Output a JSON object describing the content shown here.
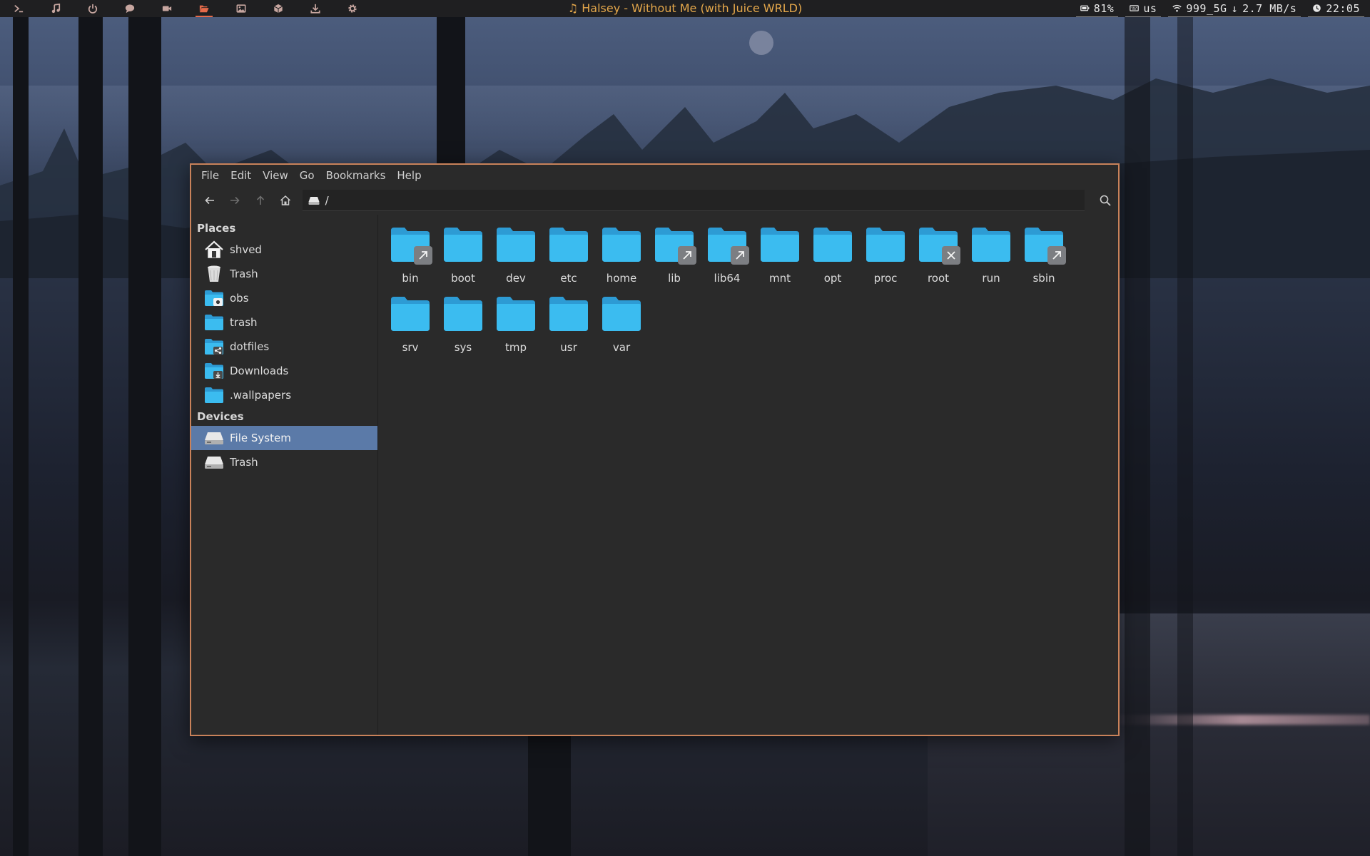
{
  "topbar": {
    "workspaces": [
      {
        "icon": "terminal-icon"
      },
      {
        "icon": "music-icon"
      },
      {
        "icon": "power-icon"
      },
      {
        "icon": "chat-icon"
      },
      {
        "icon": "video-icon"
      },
      {
        "icon": "folder-open-icon",
        "active": true
      },
      {
        "icon": "image-icon"
      },
      {
        "icon": "cube-icon"
      },
      {
        "icon": "download-icon"
      },
      {
        "icon": "settings-icon"
      }
    ],
    "now_playing": "Halsey - Without Me (with Juice WRLD)",
    "battery": "81%",
    "keyboard_layout": "us",
    "wifi": "999_5G",
    "net_speed": "2.7 MB/s",
    "clock": "22:05",
    "accent_color": "#e56a4a",
    "title_color": "#e5a84b"
  },
  "window": {
    "border_color": "#c9825a",
    "menu": [
      "File",
      "Edit",
      "View",
      "Go",
      "Bookmarks",
      "Help"
    ],
    "path": "/",
    "sidebar": {
      "places_title": "Places",
      "places": [
        {
          "label": "shved",
          "icon": "home-icon"
        },
        {
          "label": "Trash",
          "icon": "trash-bin-icon"
        },
        {
          "label": "obs",
          "icon": "camera-folder-icon"
        },
        {
          "label": "trash",
          "icon": "folder-icon"
        },
        {
          "label": "dotfiles",
          "icon": "shared-folder-icon"
        },
        {
          "label": "Downloads",
          "icon": "download-folder-icon"
        },
        {
          "label": ".wallpapers",
          "icon": "folder-icon"
        }
      ],
      "devices_title": "Devices",
      "devices": [
        {
          "label": "File System",
          "icon": "drive-icon",
          "selected": true
        },
        {
          "label": "Trash",
          "icon": "drive-icon"
        }
      ],
      "selected_color": "#5b7aa8"
    },
    "files": [
      {
        "name": "bin",
        "emblem": "symlink"
      },
      {
        "name": "boot"
      },
      {
        "name": "dev"
      },
      {
        "name": "etc"
      },
      {
        "name": "home"
      },
      {
        "name": "lib",
        "emblem": "symlink"
      },
      {
        "name": "lib64",
        "emblem": "symlink"
      },
      {
        "name": "mnt"
      },
      {
        "name": "opt"
      },
      {
        "name": "proc"
      },
      {
        "name": "root",
        "emblem": "no-access"
      },
      {
        "name": "run"
      },
      {
        "name": "sbin",
        "emblem": "symlink"
      },
      {
        "name": "srv"
      },
      {
        "name": "sys"
      },
      {
        "name": "tmp"
      },
      {
        "name": "usr"
      },
      {
        "name": "var"
      }
    ],
    "folder_color": "#3bbcf0"
  }
}
